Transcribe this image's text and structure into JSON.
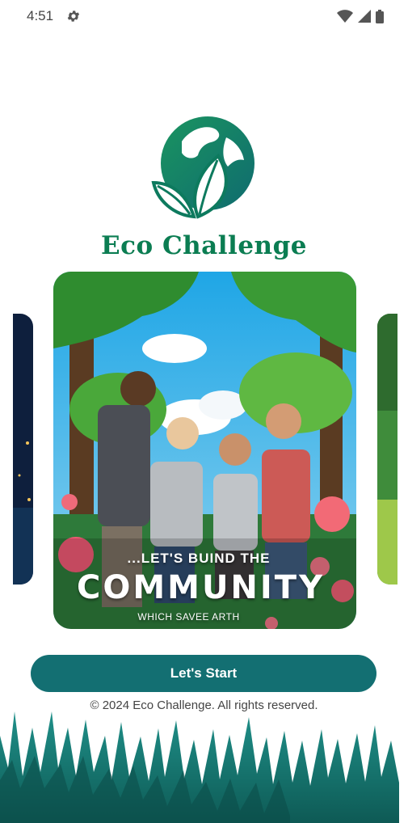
{
  "status_bar": {
    "time": "4:51",
    "icons": [
      "settings-icon",
      "wifi-icon",
      "signal-icon",
      "battery-icon"
    ]
  },
  "app": {
    "title": "Eco Challenge",
    "logo_icon": "globe-leaf-logo",
    "brand_color": "#0b7d52",
    "accent_color": "#136f72"
  },
  "carousel": {
    "active_slide": {
      "caption_line1": "...LET'S BUIND THE",
      "caption_line2": "COMMUNITY",
      "caption_line3": "WHICH SAVEE ARTH"
    }
  },
  "actions": {
    "start_label": "Let's Start"
  },
  "footer": {
    "copyright": "© 2024 Eco Challenge. All rights reserved."
  }
}
